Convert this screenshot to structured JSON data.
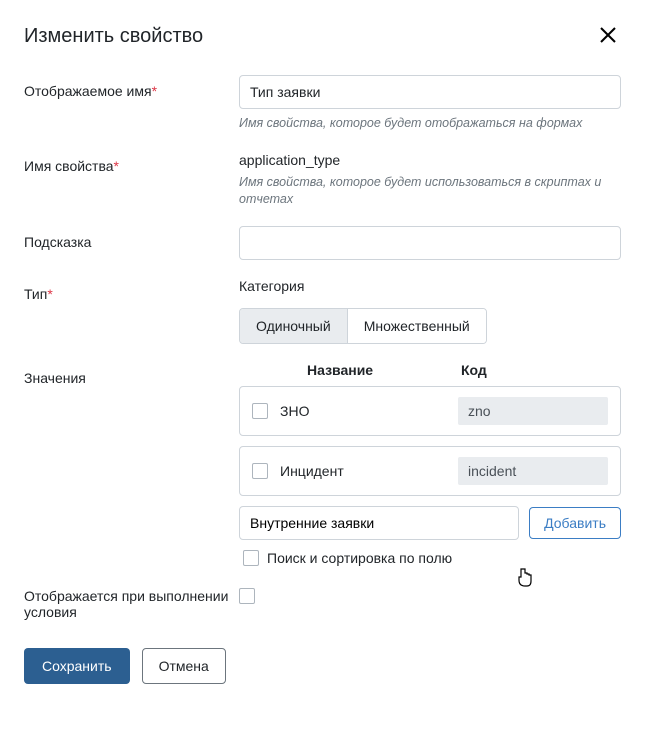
{
  "header": {
    "title": "Изменить свойство"
  },
  "fields": {
    "displayName": {
      "label": "Отображаемое имя",
      "value": "Тип заявки",
      "hint": "Имя свойства, которое будет отображаться на формах"
    },
    "propName": {
      "label": "Имя свойства",
      "value": "application_type",
      "hint": "Имя свойства, которое будет использоваться в скриптах и отчетах"
    },
    "hint": {
      "label": "Подсказка",
      "value": ""
    },
    "type": {
      "label": "Тип",
      "typeName": "Категория",
      "single": "Одиночный",
      "multiple": "Множественный"
    },
    "values": {
      "label": "Значения",
      "header_name": "Название",
      "header_code": "Код",
      "rows": [
        {
          "name": "ЗНО",
          "code": "zno"
        },
        {
          "name": "Инцидент",
          "code": "incident"
        }
      ],
      "newValue": "Внутренние заявки",
      "addBtn": "Добавить",
      "searchLabel": "Поиск и сортировка по полю"
    },
    "condition": {
      "label": "Отображается при выполнении условия"
    }
  },
  "footer": {
    "save": "Сохранить",
    "cancel": "Отмена"
  }
}
